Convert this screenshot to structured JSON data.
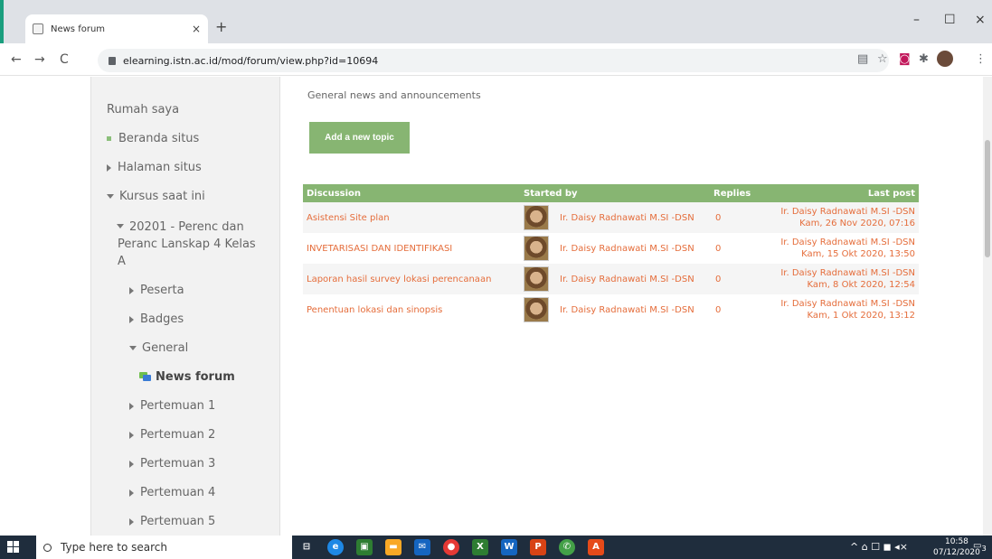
{
  "browser": {
    "tab_title": "News forum",
    "tab_close": "×",
    "new_tab": "+",
    "url": "elearning.istn.ac.id/mod/forum/view.php?id=10694",
    "back": "←",
    "forward": "→",
    "reload": "C",
    "minimize": "–",
    "maximize": "☐",
    "close": "×",
    "star": "☆",
    "menu": "⋮"
  },
  "sidebar": {
    "home": "Rumah saya",
    "site_home": "Beranda situs",
    "site_pages": "Halaman situs",
    "current_courses": "Kursus saat ini",
    "course_line1": "20201 - Perenc dan",
    "course_line2": "Peranc Lanskap 4 Kelas",
    "course_line3": "A",
    "participants": "Peserta",
    "badges": "Badges",
    "general": "General",
    "news_forum": "News forum",
    "meetings": [
      "Pertemuan 1",
      "Pertemuan 2",
      "Pertemuan 3",
      "Pertemuan 4",
      "Pertemuan 5"
    ]
  },
  "main": {
    "intro": "General news and announcements",
    "add_topic": "Add a new topic",
    "headers": {
      "discussion": "Discussion",
      "started_by": "Started by",
      "replies": "Replies",
      "last_post": "Last post"
    },
    "rows": [
      {
        "discussion": "Asistensi Site plan",
        "starter": "Ir. Daisy Radnawati M.SI -DSN",
        "replies": "0",
        "last_author": "Ir. Daisy Radnawati M.SI -DSN",
        "last_date": "Kam, 26 Nov 2020, 07:16"
      },
      {
        "discussion": "INVETARISASI DAN IDENTIFIKASI",
        "starter": "Ir. Daisy Radnawati M.SI -DSN",
        "replies": "0",
        "last_author": "Ir. Daisy Radnawati M.SI -DSN",
        "last_date": "Kam, 15 Okt 2020, 13:50"
      },
      {
        "discussion": "Laporan hasil survey lokasi perencanaan",
        "starter": "Ir. Daisy Radnawati M.SI -DSN",
        "replies": "0",
        "last_author": "Ir. Daisy Radnawati M.SI -DSN",
        "last_date": "Kam, 8 Okt 2020, 12:54"
      },
      {
        "discussion": "Penentuan lokasi dan sinopsis",
        "starter": "Ir. Daisy Radnawati M.SI -DSN",
        "replies": "0",
        "last_author": "Ir. Daisy Radnawati M.SI -DSN",
        "last_date": "Kam, 1 Okt 2020, 13:12"
      }
    ]
  },
  "taskbar": {
    "search_placeholder": "Type here to search",
    "time": "10:58",
    "date": "07/12/2020",
    "tray_icons": "^ ⌂ ☐ ◼ ◂×",
    "notif_count": "3"
  },
  "colors": {
    "accent_green": "#87b572",
    "link_orange": "#e56d3b"
  }
}
